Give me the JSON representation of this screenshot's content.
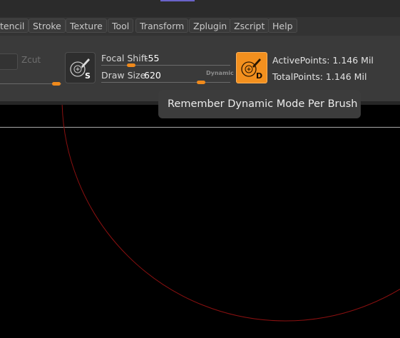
{
  "menubar": {
    "items": [
      {
        "label": "tencil"
      },
      {
        "label": "Stroke"
      },
      {
        "label": "Texture"
      },
      {
        "label": "Tool"
      },
      {
        "label": "Transform"
      },
      {
        "label": "Zplugin"
      },
      {
        "label": "Zscript"
      },
      {
        "label": "Help"
      }
    ]
  },
  "toolbar": {
    "zcut_label": "Zcut",
    "sculpt_button_letter": "S",
    "focal_shift_label": "Focal Shift",
    "focal_shift_value": "-55",
    "draw_size_label": "Draw Size",
    "draw_size_value": "620",
    "dynamic_tag": "Dynamic",
    "dynamic_button_letter": "D",
    "active_points": "ActivePoints: 1.146 Mil",
    "total_points": "TotalPoints: 1.146 Mil"
  },
  "tooltip": {
    "text": "Remember Dynamic Mode Per Brush"
  },
  "colors": {
    "accent_orange": "#f3901e",
    "brush_circle": "#8a1010",
    "panel": "#3a3a3a",
    "menubar": "#333333"
  },
  "icons": [
    "sculpt-brush-icon",
    "dynamic-brush-icon"
  ]
}
